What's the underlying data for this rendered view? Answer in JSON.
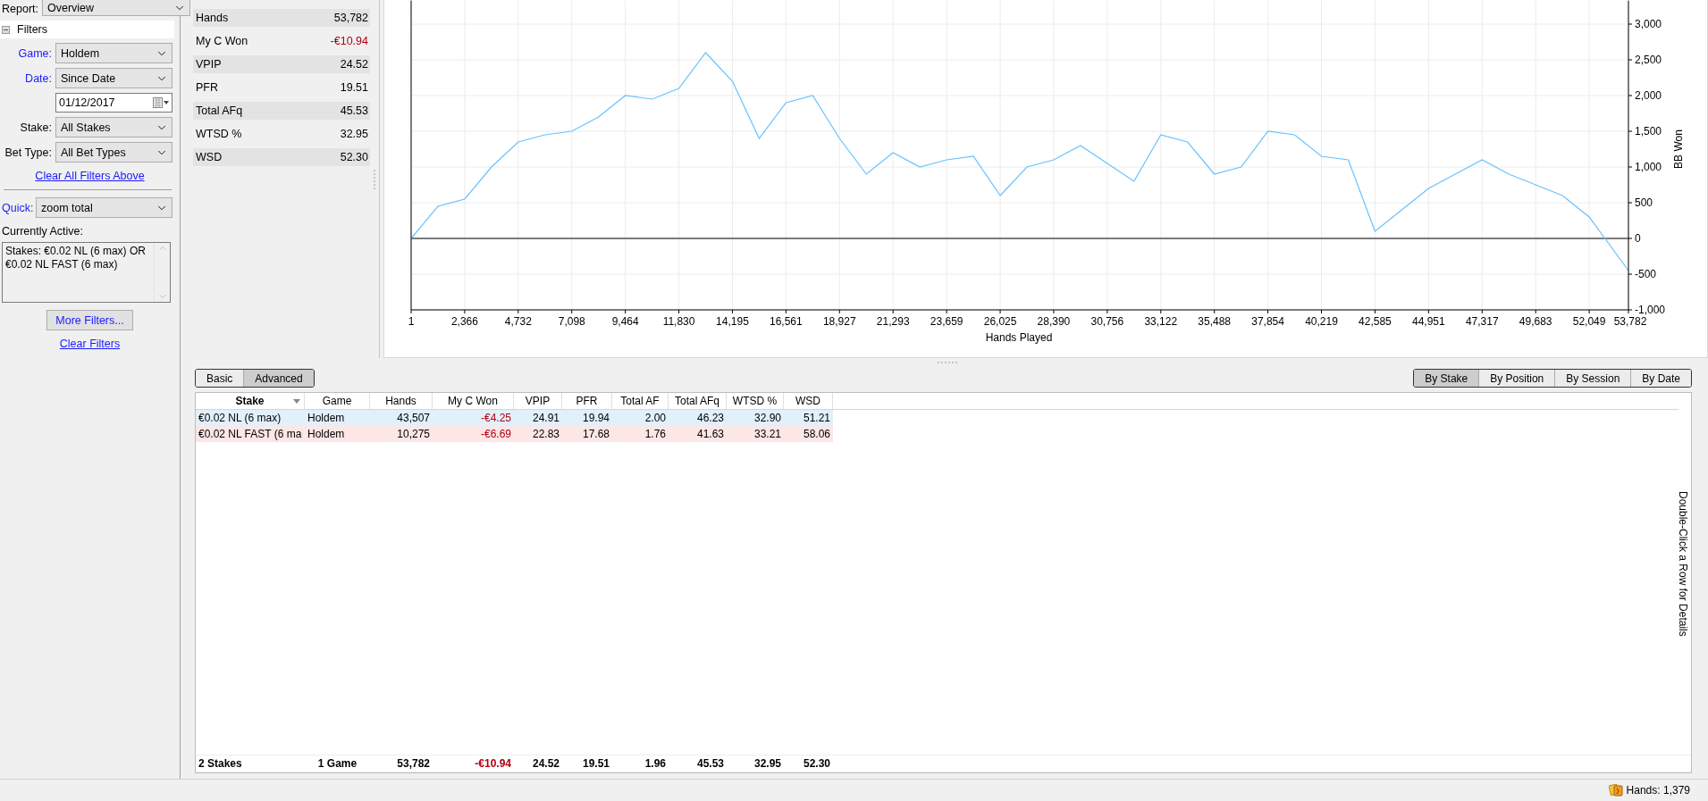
{
  "report": {
    "label": "Report:",
    "value": "Overview"
  },
  "filters": {
    "title": "Filters",
    "expanded": true
  },
  "filter_rows": [
    {
      "kind": "select",
      "label": "Game:",
      "value": "Holdem",
      "linked": true
    },
    {
      "kind": "select",
      "label": "Date:",
      "value": "Since Date",
      "linked": true
    },
    {
      "kind": "date",
      "value": "01/12/2017"
    },
    {
      "kind": "select",
      "label": "Stake:",
      "value": "All Stakes",
      "linked": false
    },
    {
      "kind": "select",
      "label": "Bet Type:",
      "value": "All Bet Types",
      "linked": false
    }
  ],
  "clear_above": "Clear All Filters Above",
  "quick": {
    "label": "Quick:",
    "value": "zoom total"
  },
  "currently_active": {
    "label": "Currently Active:",
    "text": "Stakes: €0.02 NL (6 max) OR €0.02 NL FAST (6 max)"
  },
  "more_filters": "More Filters...",
  "clear_filters": "Clear Filters",
  "stats": [
    {
      "label": "Hands",
      "value": "53,782",
      "kind": "plain"
    },
    {
      "label": "My C Won",
      "value": "-€10.94",
      "kind": "money"
    },
    {
      "label": "VPIP",
      "value": "24.52",
      "kind": "plain"
    },
    {
      "label": "PFR",
      "value": "19.51",
      "kind": "plain"
    },
    {
      "label": "Total AFq",
      "value": "45.53",
      "kind": "plain"
    },
    {
      "label": "WTSD %",
      "value": "32.95",
      "kind": "plain"
    },
    {
      "label": "WSD",
      "value": "52.30",
      "kind": "plain"
    }
  ],
  "chart_data": {
    "type": "line",
    "xlabel": "Hands Played",
    "ylabel": "BB Won",
    "xlim": [
      1,
      53782
    ],
    "ylim": [
      -1000,
      3330
    ],
    "grid": true,
    "xticks": [
      1,
      {
        "value": 2366,
        "label": "2,366"
      },
      {
        "value": 4732,
        "label": "4,732"
      },
      {
        "value": 7098,
        "label": "7,098"
      },
      {
        "value": 9464,
        "label": "9,464"
      },
      {
        "value": 11830,
        "label": "11,830"
      },
      {
        "value": 14195,
        "label": "14,195"
      },
      {
        "value": 16561,
        "label": "16,561"
      },
      {
        "value": 18927,
        "label": "18,927"
      },
      {
        "value": 21293,
        "label": "21,293"
      },
      {
        "value": 23659,
        "label": "23,659"
      },
      {
        "value": 26025,
        "label": "26,025"
      },
      {
        "value": 28390,
        "label": "28,390"
      },
      {
        "value": 30756,
        "label": "30,756"
      },
      {
        "value": 33122,
        "label": "33,122"
      },
      {
        "value": 35488,
        "label": "35,488"
      },
      {
        "value": 37854,
        "label": "37,854"
      },
      {
        "value": 40219,
        "label": "40,219"
      },
      {
        "value": 42585,
        "label": "42,585"
      },
      {
        "value": 44951,
        "label": "44,951"
      },
      {
        "value": 47317,
        "label": "47,317"
      },
      {
        "value": 49683,
        "label": "49,683"
      },
      {
        "value": 52049,
        "label": "52,049"
      },
      {
        "value": 53782,
        "label": "53,782"
      }
    ],
    "yticks": [
      {
        "value": -1000,
        "label": "-1,000"
      },
      -500,
      0,
      500,
      {
        "value": 1000,
        "label": "1,000"
      },
      {
        "value": 1500,
        "label": "1,500"
      },
      {
        "value": 2000,
        "label": "2,000"
      },
      {
        "value": 2500,
        "label": "2,500"
      },
      {
        "value": 3000,
        "label": "3,000"
      }
    ],
    "x": [
      1,
      1184,
      2366,
      3549,
      4732,
      5915,
      7098,
      8281,
      9464,
      10647,
      11830,
      13013,
      14195,
      15378,
      16561,
      17744,
      18927,
      20110,
      21293,
      22476,
      23659,
      24842,
      26025,
      27208,
      28390,
      29573,
      30756,
      31939,
      33122,
      34305,
      35488,
      36671,
      37854,
      39037,
      40219,
      41402,
      42585,
      43768,
      44951,
      46134,
      47317,
      48500,
      49683,
      50866,
      52049,
      53782
    ],
    "series": [
      {
        "color": "#66c2ff",
        "values": [
          0,
          450,
          550,
          1000,
          1350,
          1450,
          1500,
          1700,
          2000,
          1950,
          2100,
          2600,
          2200,
          1400,
          1900,
          2000,
          1400,
          900,
          1200,
          1000,
          1100,
          1150,
          600,
          1000,
          1100,
          1300,
          1050,
          800,
          1450,
          1350,
          900,
          1000,
          1500,
          1450,
          1150,
          1100,
          100,
          400,
          700,
          900,
          1100,
          900,
          750,
          600,
          300,
          -450
        ]
      }
    ]
  },
  "view_tabs": [
    {
      "label": "Basic",
      "selected": false
    },
    {
      "label": "Advanced",
      "selected": true
    }
  ],
  "group_buttons": [
    {
      "label": "By Stake",
      "selected": true
    },
    {
      "label": "By Position",
      "selected": false
    },
    {
      "label": "By Session",
      "selected": false
    },
    {
      "label": "By Date",
      "selected": false
    }
  ],
  "table": {
    "columns": [
      {
        "label": "Stake",
        "kind": "text",
        "sorted": true
      },
      {
        "label": "Game",
        "kind": "text",
        "sorted": false
      },
      {
        "label": "Hands",
        "kind": "number",
        "sorted": false
      },
      {
        "label": "My C Won",
        "kind": "money",
        "sorted": false
      },
      {
        "label": "VPIP",
        "kind": "number",
        "sorted": false
      },
      {
        "label": "PFR",
        "kind": "number",
        "sorted": false
      },
      {
        "label": "Total AF",
        "kind": "number",
        "sorted": false
      },
      {
        "label": "Total AFq",
        "kind": "number",
        "sorted": false
      },
      {
        "label": "WTSD %",
        "kind": "number",
        "sorted": false
      },
      {
        "label": "WSD",
        "kind": "number",
        "sorted": false
      }
    ],
    "rows": [
      {
        "color": "#e1f0fb",
        "cells": [
          "€0.02 NL (6 max)",
          "Holdem",
          "43,507",
          "-€4.25",
          "24.91",
          "19.94",
          "2.00",
          "46.23",
          "32.90",
          "51.21"
        ]
      },
      {
        "color": "#fce6e6",
        "cells": [
          "€0.02 NL FAST (6 ma",
          "Holdem",
          "10,275",
          "-€6.69",
          "22.83",
          "17.68",
          "1.76",
          "41.63",
          "33.21",
          "58.06"
        ]
      }
    ],
    "totals": [
      "2 Stakes",
      "1 Game",
      "53,782",
      "-€10.94",
      "24.52",
      "19.51",
      "1.96",
      "45.53",
      "32.95",
      "52.30"
    ]
  },
  "hint": "Double-Click a Row for Details",
  "status_bar": {
    "hands": "Hands: 1,379"
  }
}
